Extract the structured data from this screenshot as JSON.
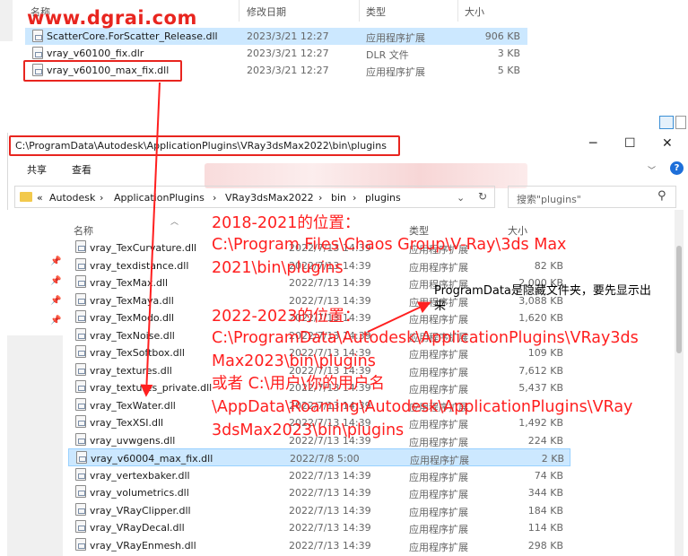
{
  "watermark": "www.dgrai.com",
  "top_window": {
    "headers": {
      "name": "名称",
      "date": "修改日期",
      "type": "类型",
      "size": "大小"
    },
    "files": [
      {
        "name": "ScatterCore.ForScatter_Release.dll",
        "date": "2023/3/21 12:27",
        "type": "应用程序扩展",
        "size": "906 KB",
        "selected": true
      },
      {
        "name": "vray_v60100_fix.dlr",
        "date": "2023/3/21 12:27",
        "type": "DLR 文件",
        "size": "3 KB",
        "selected": false
      },
      {
        "name": "vray_v60100_max_fix.dll",
        "date": "2023/3/21 12:27",
        "type": "应用程序扩展",
        "size": "5 KB",
        "selected": false
      }
    ]
  },
  "front_window": {
    "title_path": "C:\\ProgramData\\Autodesk\\ApplicationPlugins\\VRay3dsMax2022\\bin\\plugins",
    "menu": {
      "share": "共享",
      "view": "查看"
    },
    "breadcrumb": [
      "«",
      "Autodesk",
      "ApplicationPlugins",
      "VRay3dsMax2022",
      "bin",
      "plugins"
    ],
    "search_placeholder": "搜索\"plugins\"",
    "headers": {
      "name": "名称",
      "type": "类型",
      "size": "大小"
    },
    "files": [
      {
        "name": "vray_TexCurvature.dll",
        "date": "2022/7/13 14:39",
        "type": "应用程序扩展",
        "size": "",
        "selected": false
      },
      {
        "name": "vray_texdistance.dll",
        "date": "2022/7/13 14:39",
        "type": "应用程序扩展",
        "size": "82 KB",
        "selected": false
      },
      {
        "name": "vray_TexMax.dll",
        "date": "2022/7/13 14:39",
        "type": "应用程序扩展",
        "size": "2,000 KB",
        "selected": false
      },
      {
        "name": "vray_TexMaya.dll",
        "date": "2022/7/13 14:39",
        "type": "应用程序扩展",
        "size": "3,088 KB",
        "selected": false
      },
      {
        "name": "vray_TexModo.dll",
        "date": "2022/7/13 14:39",
        "type": "应用程序扩展",
        "size": "1,620 KB",
        "selected": false
      },
      {
        "name": "vray_TexNoise.dll",
        "date": "2022/7/13 14:39",
        "type": "应用程序扩展",
        "size": "",
        "selected": false
      },
      {
        "name": "vray_TexSoftbox.dll",
        "date": "2022/7/13 14:39",
        "type": "应用程序扩展",
        "size": "109 KB",
        "selected": false
      },
      {
        "name": "vray_textures.dll",
        "date": "2022/7/13 14:39",
        "type": "应用程序扩展",
        "size": "7,612 KB",
        "selected": false
      },
      {
        "name": "vray_textures_private.dll",
        "date": "2022/7/13 14:39",
        "type": "应用程序扩展",
        "size": "5,437 KB",
        "selected": false
      },
      {
        "name": "vray_TexWater.dll",
        "date": "2022/7/13 14:39",
        "type": "应用程序扩展",
        "size": "",
        "selected": false
      },
      {
        "name": "vray_TexXSI.dll",
        "date": "2022/7/13 14:39",
        "type": "应用程序扩展",
        "size": "1,492 KB",
        "selected": false
      },
      {
        "name": "vray_uvwgens.dll",
        "date": "2022/7/13 14:39",
        "type": "应用程序扩展",
        "size": "224 KB",
        "selected": false
      },
      {
        "name": "vray_v60004_max_fix.dll",
        "date": "2022/7/8 5:00",
        "type": "应用程序扩展",
        "size": "2 KB",
        "selected": true
      },
      {
        "name": "vray_vertexbaker.dll",
        "date": "2022/7/13 14:39",
        "type": "应用程序扩展",
        "size": "74 KB",
        "selected": false
      },
      {
        "name": "vray_volumetrics.dll",
        "date": "2022/7/13 14:39",
        "type": "应用程序扩展",
        "size": "344 KB",
        "selected": false
      },
      {
        "name": "vray_VRayClipper.dll",
        "date": "2022/7/13 14:39",
        "type": "应用程序扩展",
        "size": "184 KB",
        "selected": false
      },
      {
        "name": "vray_VRayDecal.dll",
        "date": "2022/7/13 14:39",
        "type": "应用程序扩展",
        "size": "114 KB",
        "selected": false
      },
      {
        "name": "vray_VRayEnmesh.dll",
        "date": "2022/7/13 14:39",
        "type": "应用程序扩展",
        "size": "298 KB",
        "selected": false
      }
    ]
  },
  "annotations": {
    "loc2018_title": "2018-2021的位置：",
    "loc2018_line1": "C:\\Program Files\\Chaos Group\\V-Ray\\3ds Max",
    "loc2018_line2": "2021\\bin\\plugins",
    "hidden_note_line1": "ProgramData是隐藏文件夹，要先显示出",
    "hidden_note_line2": "来",
    "loc2022_title": "2022-2023的位置：",
    "loc2022_line1": "C:\\ProgramData\\Autodesk\\ApplicationPlugins\\VRay3ds",
    "loc2022_line2": "Max2023\\bin\\plugins",
    "loc2022_line3": "或者 C:\\用户\\你的用户名",
    "loc2022_line4": "\\AppData\\Roaming\\Autodesk\\ApplicationPlugins\\VRay",
    "loc2022_line5": "3dsMax2023\\bin\\plugins"
  }
}
